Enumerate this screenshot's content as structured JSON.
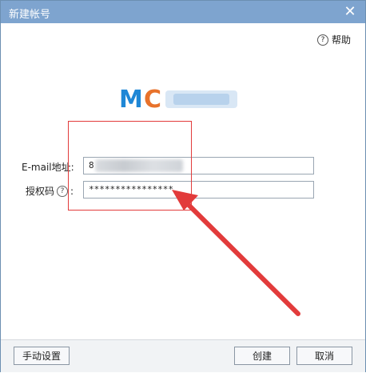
{
  "window": {
    "title": "新建帐号",
    "close_symbol": "✕"
  },
  "help": {
    "symbol": "?",
    "label": "帮助"
  },
  "logo": {
    "text": "MC",
    "colors": {
      "m": "#1f87d6",
      "c": "#e8722b"
    }
  },
  "form": {
    "email_label": "E-mail地址:",
    "email_value": "8",
    "auth_label": "授权码",
    "auth_help_symbol": "?",
    "auth_colon": ":",
    "auth_value": "****************"
  },
  "footer": {
    "manual_label": "手动设置",
    "create_label": "创建",
    "cancel_label": "取消"
  },
  "colors": {
    "titlebar": "#7ea4cf",
    "highlight": "#e23b3b"
  }
}
